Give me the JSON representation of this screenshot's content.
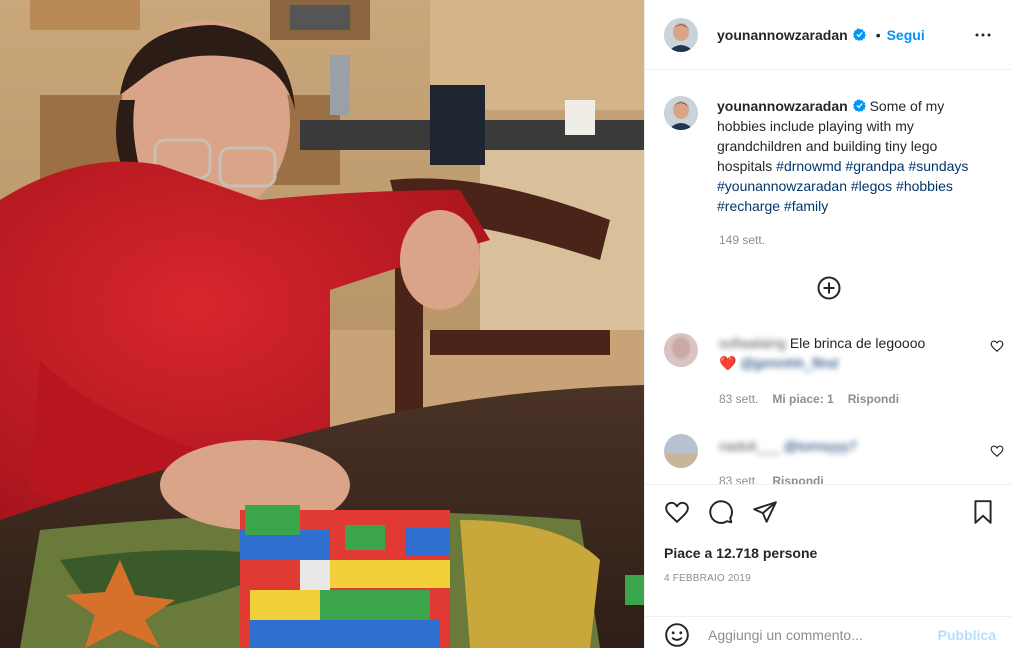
{
  "post": {
    "username": "younannowzaradan",
    "follow_label": "Segui",
    "dot": "•"
  },
  "caption": {
    "username": "younannowzaradan",
    "text": "Some of my hobbies include playing with my grandchildren and building tiny lego hospitals",
    "hashtags": "#drnowmd #grandpa #sundays #younannowzaradan #legos #hobbies #recharge #family",
    "time": "149 sett."
  },
  "comments": [
    {
      "username": "sofiaalaing",
      "text": "Ele brinca de legoooo",
      "emoji": "❤️",
      "mention": "@jpmmhh_fllnd",
      "time": "83 sett.",
      "likes": "Mi piace: 1",
      "reply": "Rispondi"
    },
    {
      "username": "nadoli___",
      "mention": "@tomsyyy7",
      "time": "83 sett.",
      "reply": "Rispondi"
    }
  ],
  "actions": {
    "likes_text": "Piace a 12.718 persone",
    "date": "4 febbraio 2019"
  },
  "comment_box": {
    "placeholder": "Aggiungi un commento...",
    "publish_label": "Pubblica"
  },
  "icons": [
    "verified-badge-icon",
    "more-options-icon",
    "load-more-comments-icon",
    "heart-icon",
    "comment-icon",
    "share-icon",
    "bookmark-icon",
    "emoji-icon"
  ],
  "colors": {
    "accent": "#0095f6",
    "text": "#262626",
    "muted": "#8e8e8e",
    "hashtag": "#00376b",
    "publish_disabled": "#b2dffc"
  }
}
